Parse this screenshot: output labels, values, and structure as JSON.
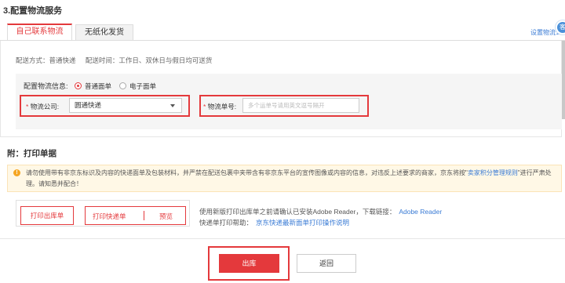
{
  "page": {
    "section_title": "3.配置物流服务",
    "settings_link": "设置物流公",
    "help_bubble": "客"
  },
  "tabs": [
    {
      "label": "自己联系物流",
      "active": true
    },
    {
      "label": "无纸化发货",
      "active": false
    }
  ],
  "delivery": {
    "method_label": "配送方式：普通快递",
    "time_label": "配送时间：工作日、双休日与假日均可送货"
  },
  "config": {
    "label": "配置物流信息:",
    "radio_options": [
      {
        "label": "普通面单",
        "selected": true
      },
      {
        "label": "电子面单",
        "selected": false
      }
    ],
    "company_label": "物流公司:",
    "company_value": "圆通快递",
    "tracking_label": "物流单号:",
    "tracking_placeholder": "多个运单号请用英文逗号隔开"
  },
  "print": {
    "section_title": "附：打印单据",
    "notice_part1": "请勿使用带有非京东标识及内容的快递面单及包装材料，并严禁在配送包裹中夹带含有非京东平台的宣传图像或内容的信息，对违反上述要求的商家，京东将按\"",
    "notice_link": "卖家积分管理规则",
    "notice_part2": "\"进行严肃处理。请知悉并配合！",
    "btn_print_stock": "打印出库单",
    "btn_print_express": "打印快递单",
    "btn_preview": "预览",
    "tip1_text": "使用新版打印出库单之前请确认已安装Adobe Reader，下载链接：",
    "tip1_link": "Adobe Reader",
    "tip2_text": "快递单打印帮助：",
    "tip2_link": "京东快递最新面单打印操作说明"
  },
  "actions": {
    "submit": "出库",
    "back": "返回"
  },
  "colors": {
    "accent": "#e4393c",
    "link": "#3a7bd5",
    "notice_bg": "#fff8e6"
  }
}
